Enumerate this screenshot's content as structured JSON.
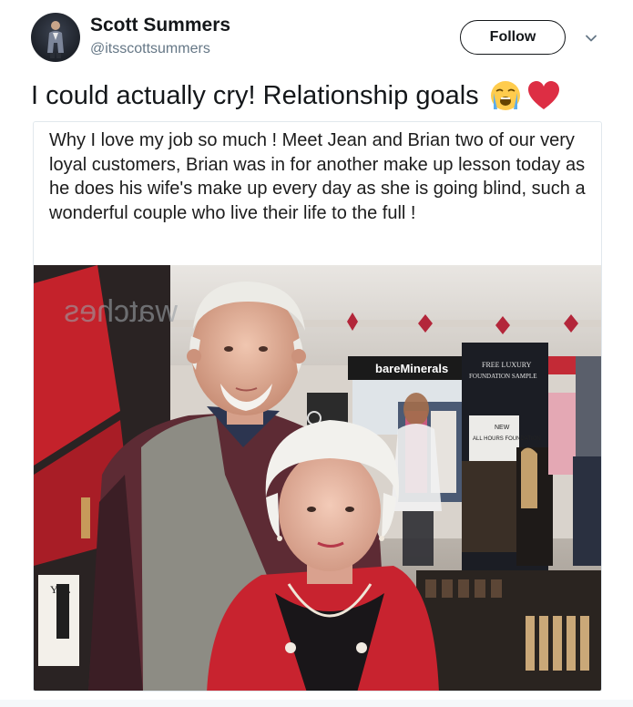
{
  "user": {
    "display_name": "Scott Summers",
    "handle": "@itsscottsummers"
  },
  "actions": {
    "follow_label": "Follow",
    "more_icon": "chevron-down-icon"
  },
  "tweet": {
    "text": "I could actually cry! Relationship goals",
    "emojis": [
      "loudly-crying-face-icon",
      "red-heart-icon"
    ]
  },
  "quoted_post": {
    "text": "Why I love my job so much ! Meet Jean and Brian two of our very loyal customers, Brian was in for another make up lesson today as he does his wife's make up every day as she is going blind, such a wonderful couple who live their life to the full !"
  },
  "photo": {
    "store_signs": {
      "brand_banner": "bareMinerals",
      "promo_line1": "FREE LUXURY",
      "promo_line2": "FOUNDATION SAMPLE",
      "wall_text": "watches",
      "panel_line1": "NEW",
      "panel_line2": "ALL HOURS FOUNDATION",
      "logo": "YSL"
    }
  },
  "colors": {
    "text_primary": "#14171a",
    "text_secondary": "#657786",
    "border": "#e1e8ed",
    "heart": "#e0245e"
  }
}
